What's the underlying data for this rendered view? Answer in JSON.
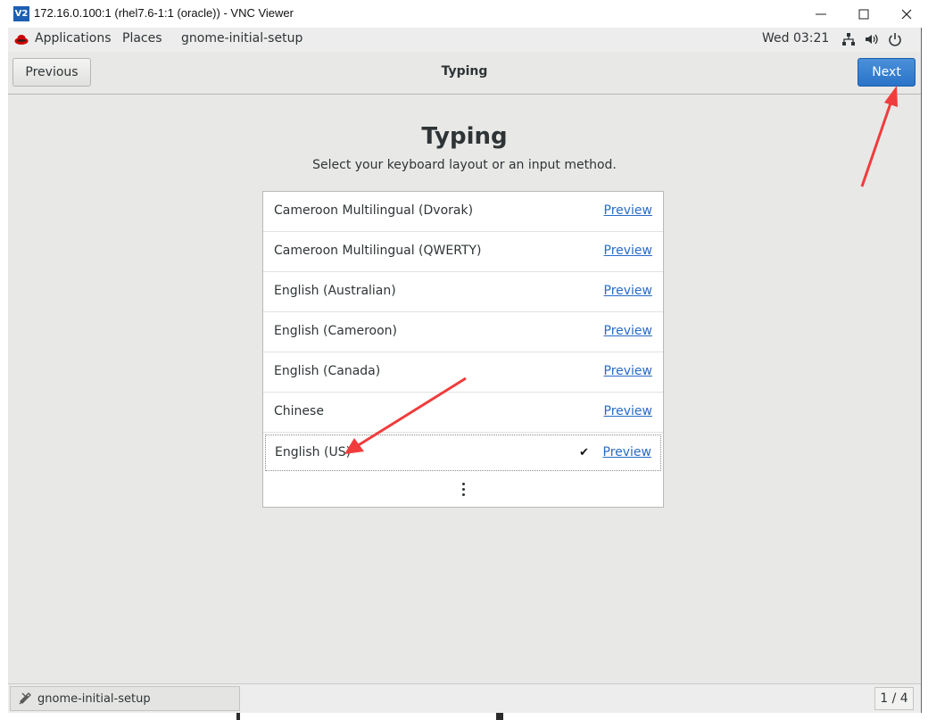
{
  "window": {
    "title": "172.16.0.100:1 (rhel7.6-1:1 (oracle)) - VNC Viewer",
    "logo_text": "V2",
    "controls": [
      "minimize-icon",
      "maximize-icon",
      "close-icon"
    ]
  },
  "topbar": {
    "applications": "Applications",
    "places": "Places",
    "app_name": "gnome-initial-setup",
    "clock": "Wed 03:21",
    "icons": [
      "network-icon",
      "volume-icon",
      "power-icon"
    ]
  },
  "header": {
    "previous": "Previous",
    "title": "Typing",
    "next": "Next"
  },
  "page": {
    "title": "Typing",
    "subtitle": "Select your keyboard layout or an input method."
  },
  "layouts": [
    {
      "name": "Cameroon Multilingual (Dvorak)",
      "preview": "Preview"
    },
    {
      "name": "Cameroon Multilingual (QWERTY)",
      "preview": "Preview"
    },
    {
      "name": "English (Australian)",
      "preview": "Preview"
    },
    {
      "name": "English (Cameroon)",
      "preview": "Preview"
    },
    {
      "name": "English (Canada)",
      "preview": "Preview"
    },
    {
      "name": "Chinese",
      "preview": "Preview"
    },
    {
      "name": "English (US)",
      "preview": "Preview",
      "selected": true
    }
  ],
  "taskbar": {
    "task": "gnome-initial-setup",
    "workspace": "1 / 4"
  },
  "colors": {
    "accent": "#2a73c8",
    "link": "#2a6bc4",
    "arrow": "#f03c3c",
    "background": "#e8e8e7"
  }
}
